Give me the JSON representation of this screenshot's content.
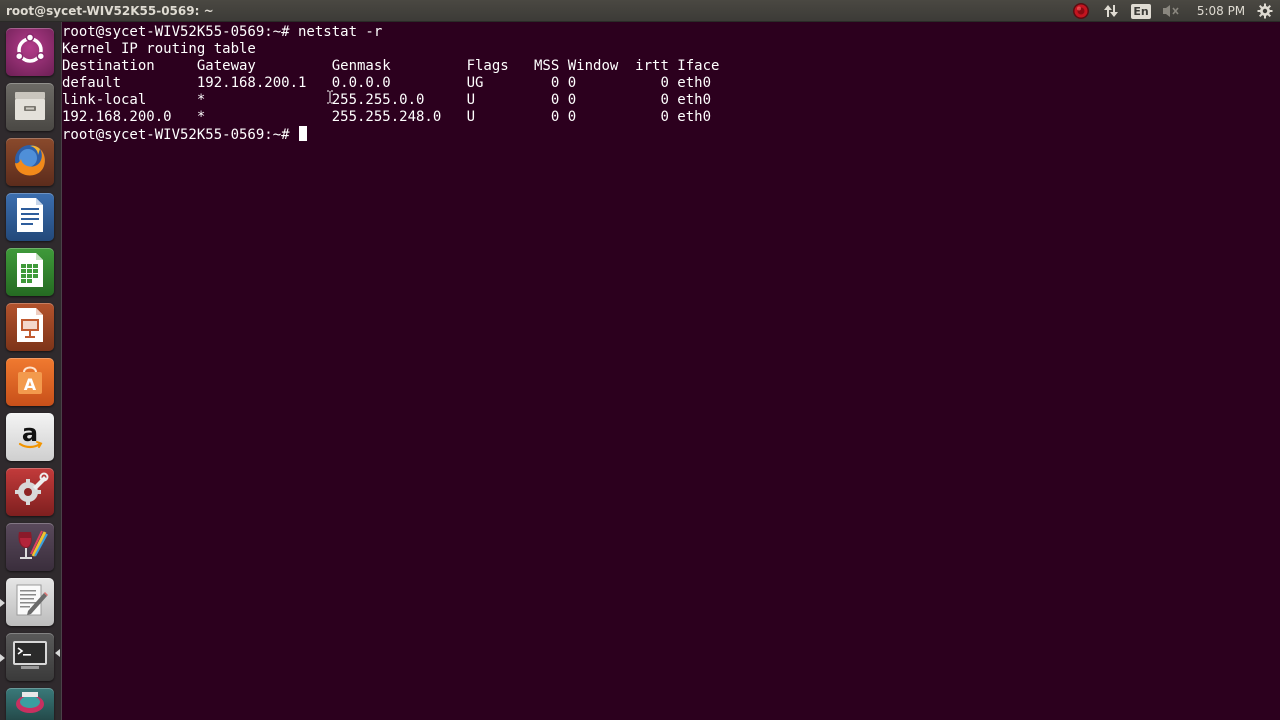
{
  "topbar": {
    "window_title": "root@sycet-WIV52K55-0569: ~",
    "keyboard_layout": "En",
    "clock": "5:08 PM",
    "icons": [
      "record-indicator-icon",
      "network-updown-icon",
      "keyboard-layout-icon",
      "volume-muted-icon",
      "settings-gear-icon"
    ]
  },
  "launcher": {
    "items": [
      {
        "name": "dash-home",
        "icon": "ubuntu-logo-icon",
        "active": false
      },
      {
        "name": "files",
        "icon": "file-cabinet-icon",
        "active": false
      },
      {
        "name": "firefox",
        "icon": "firefox-icon",
        "active": false
      },
      {
        "name": "libreoffice-writer",
        "icon": "writer-document-icon",
        "active": false
      },
      {
        "name": "libreoffice-calc",
        "icon": "calc-spreadsheet-icon",
        "active": false
      },
      {
        "name": "libreoffice-impress",
        "icon": "impress-presentation-icon",
        "active": false
      },
      {
        "name": "software-center",
        "icon": "shopping-bag-icon",
        "active": false
      },
      {
        "name": "amazon",
        "icon": "amazon-logo-icon",
        "active": false
      },
      {
        "name": "system-settings",
        "icon": "settings-wrench-icon",
        "active": false
      },
      {
        "name": "wine",
        "icon": "wine-glass-icon",
        "active": false
      },
      {
        "name": "text-editor",
        "icon": "text-editor-icon",
        "active": true
      },
      {
        "name": "terminal",
        "icon": "terminal-icon",
        "active": true,
        "focused": true
      },
      {
        "name": "partial-app",
        "icon": "app-icon",
        "active": false
      }
    ]
  },
  "terminal": {
    "lines": [
      "root@sycet-WIV52K55-0569:~# netstat -r",
      "Kernel IP routing table",
      "Destination     Gateway         Genmask         Flags   MSS Window  irtt Iface",
      "default         192.168.200.1   0.0.0.0         UG        0 0          0 eth0",
      "link-local      *               255.255.0.0     U         0 0          0 eth0",
      "192.168.200.0   *               255.255.248.0   U         0 0          0 eth0"
    ],
    "prompt": "root@sycet-WIV52K55-0569:~# "
  },
  "colors": {
    "terminal_bg": "#2c001e",
    "terminal_fg": "#ffffff",
    "panel_bg": "#3c3b37",
    "launcher_bg": "#2f2a2d"
  }
}
